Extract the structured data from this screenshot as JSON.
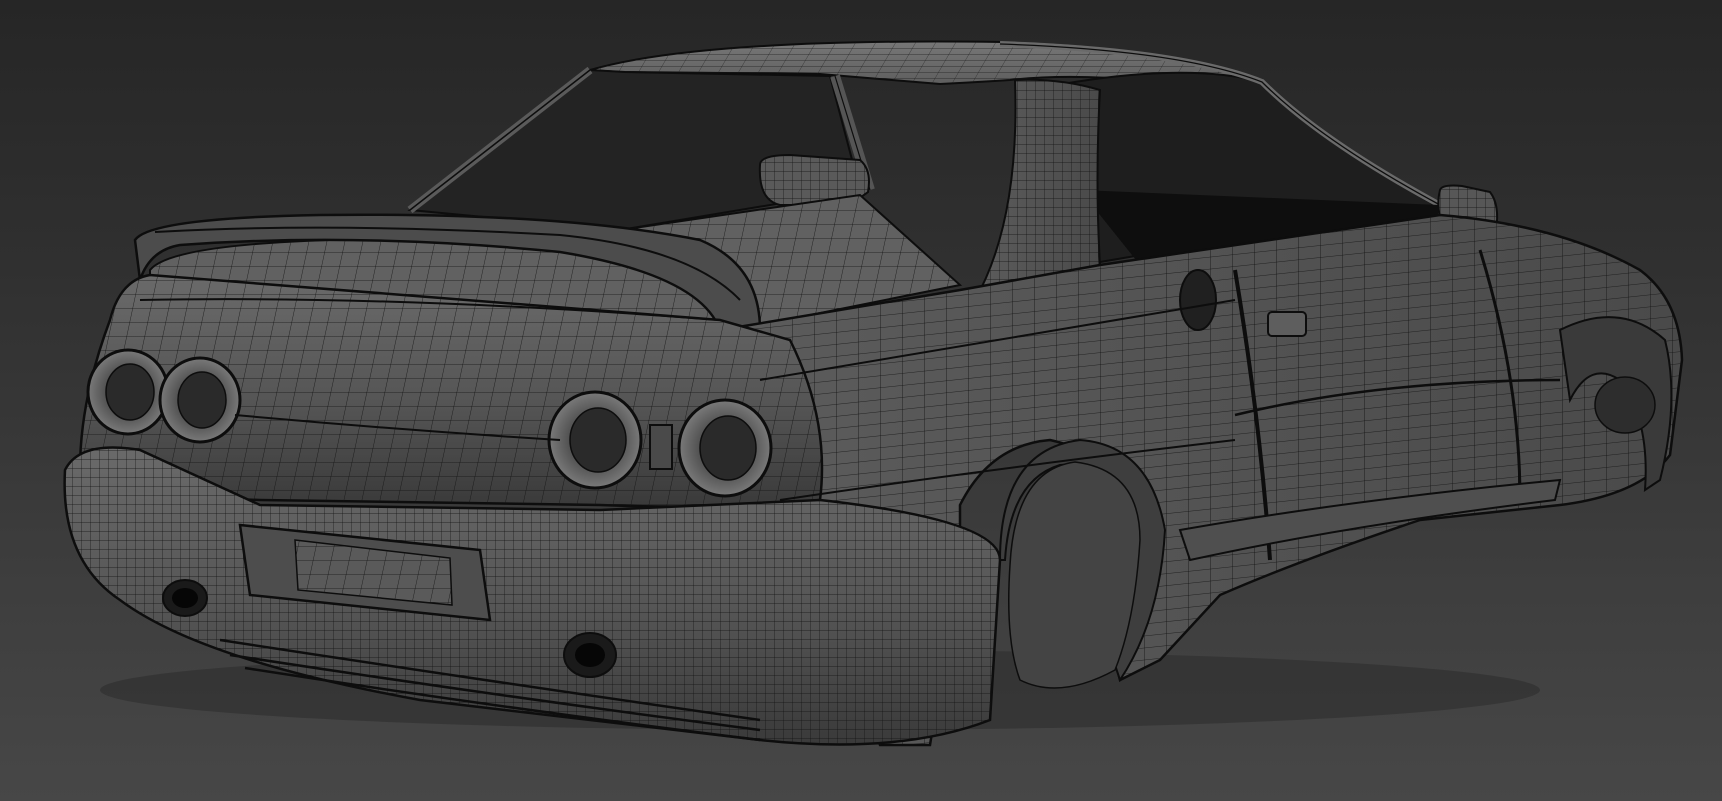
{
  "viewport": {
    "background_top": "#262626",
    "background_bottom": "#474747",
    "shading_mode": "wireframe-on-shaded"
  },
  "model": {
    "subject": "car-body-shell",
    "view": "rear-three-quarter",
    "surface_color": "#5a5a5a",
    "surface_dark": "#2a2a2a",
    "wire_color": "#0d0d0d",
    "glass_color": "#151515",
    "parts": [
      "roof",
      "windshield-frame",
      "side-window-frame",
      "c-pillar",
      "rear-spoiler",
      "trunk-lid",
      "rear-panel",
      "tail-lights",
      "rear-bumper",
      "license-plate-recess",
      "exhaust-pipes",
      "rear-wheel-arch",
      "door",
      "door-handle",
      "fuel-cap",
      "side-mirrors",
      "side-skirt",
      "front-wheel-arch"
    ]
  }
}
